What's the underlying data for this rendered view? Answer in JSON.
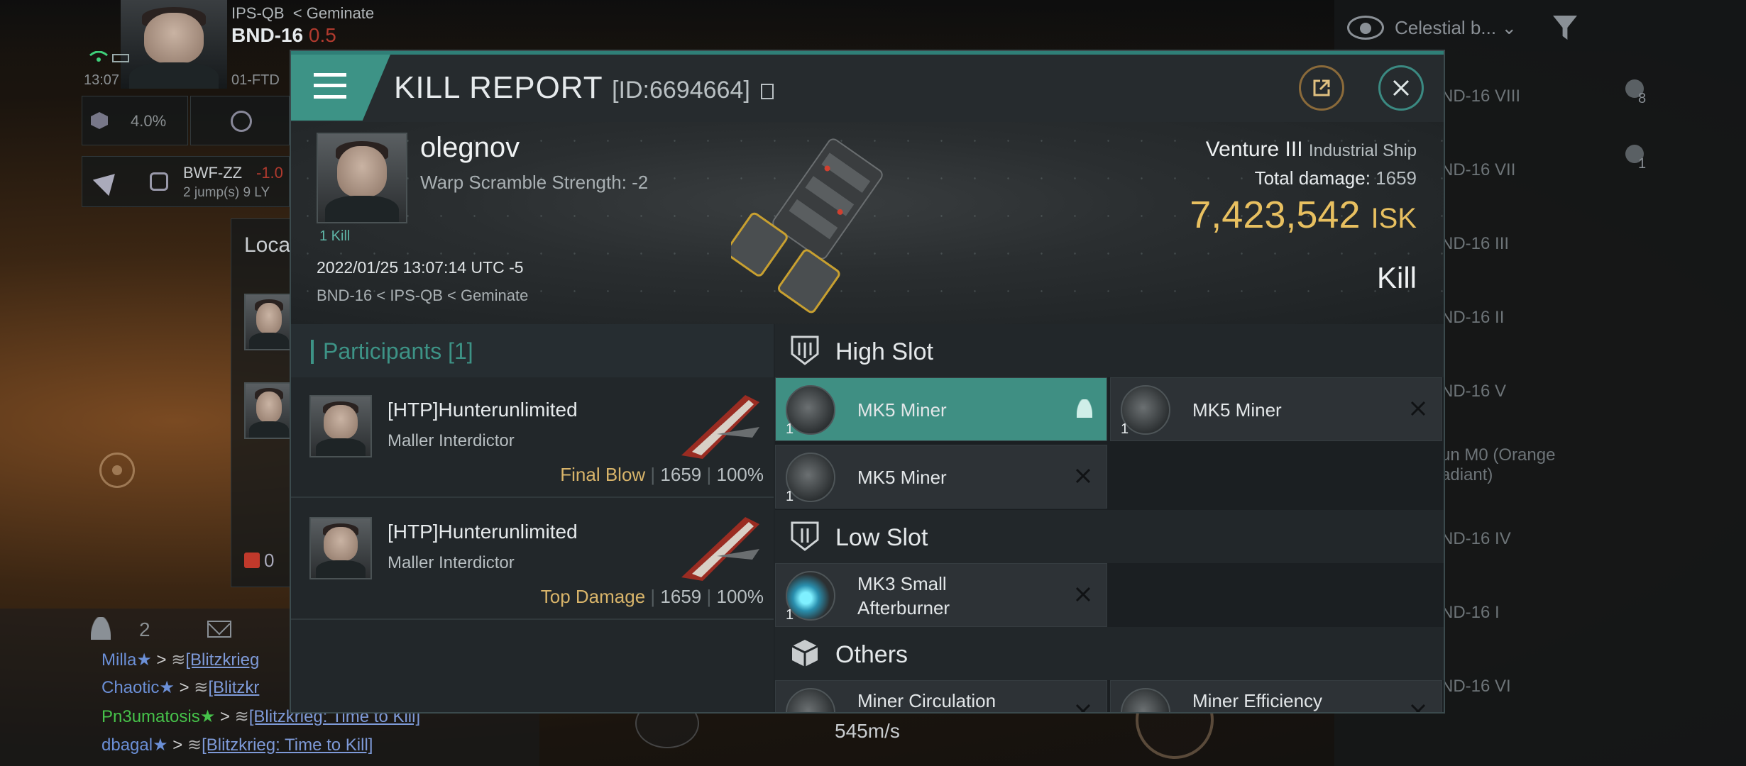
{
  "hud": {
    "pilot_location": "IPS-QB",
    "pilot_region": "Geminate",
    "system": "BND-16",
    "security": "0.5",
    "time": "13:07",
    "corp_ticker": "01-FTD",
    "cargo_percent": "4.0%",
    "destination": "BWF-ZZ",
    "destination_suffix": "-1.0",
    "jumps": "2 jump(s) 9 LY",
    "local_label": "Loca",
    "local_count": "0",
    "overview_filter": "Celestial b...",
    "speed": "545m/s",
    "people_count": "2"
  },
  "overview": {
    "items": [
      "ND-16 VIII",
      "ND-16 VII",
      "ND-16 III",
      "ND-16 II",
      "ND-16 V",
      "un M0 (Orange",
      "adiant)",
      "ND-16 IV",
      "ND-16 I",
      "ND-16 VI"
    ],
    "counts": [
      "8",
      "1"
    ]
  },
  "chat": [
    {
      "name": "Milla",
      "color": "#6b8fd6",
      "link": "[Blitzkrieg"
    },
    {
      "name": "Chaotic",
      "color": "#6b8fd6",
      "link": "[Blitzkr"
    },
    {
      "name": "Pn3umatosis",
      "color": "#46c24a",
      "link": "[Blitzkrieg: Time to Kill]"
    },
    {
      "name": "dbagal",
      "color": "#6b8fd6",
      "link": "[Blitzkrieg: Time to Kill]"
    }
  ],
  "report": {
    "title": "KILL REPORT",
    "id": "[ID:6694664]",
    "victim": {
      "name": "olegnov",
      "warp_scramble": "Warp Scramble Strength: -2",
      "kills": "1 Kill",
      "datetime": "2022/01/25 13:07:14 UTC -5",
      "location": "BND-16 < IPS-QB < Geminate",
      "ship_name": "Venture III",
      "ship_class": "Industrial Ship",
      "total_damage_label": "Total damage:",
      "total_damage": "1659",
      "isk_value": "7,423,542",
      "isk_unit": "ISK",
      "result": "Kill"
    },
    "participants": {
      "header": "Participants",
      "count": "[1]",
      "rows": [
        {
          "name": "[HTP]Hunterunlimited",
          "ship": "Maller Interdictor",
          "tag": "Final Blow",
          "damage": "1659",
          "percent": "100%"
        },
        {
          "name": "[HTP]Hunterunlimited",
          "ship": "Maller Interdictor",
          "tag": "Top Damage",
          "damage": "1659",
          "percent": "100%"
        }
      ]
    },
    "slots": {
      "high": "High Slot",
      "low": "Low Slot",
      "others": "Others",
      "high_items": [
        {
          "name": "MK5 Miner",
          "qty": "1"
        },
        {
          "name": "MK5 Miner",
          "qty": "1"
        },
        {
          "name": "MK5 Miner",
          "qty": "1"
        }
      ],
      "low_items": [
        {
          "name1": "MK3 Small",
          "name2": "Afterburner",
          "qty": "1"
        }
      ],
      "other_items": [
        {
          "name": "Miner Circulation"
        },
        {
          "name": "Miner Efficiency"
        }
      ]
    }
  },
  "colors": {
    "accent_teal": "#3d9386",
    "gold": "#e8c060",
    "tag_gold": "#d8b46a",
    "security_red": "#b03a2e"
  }
}
